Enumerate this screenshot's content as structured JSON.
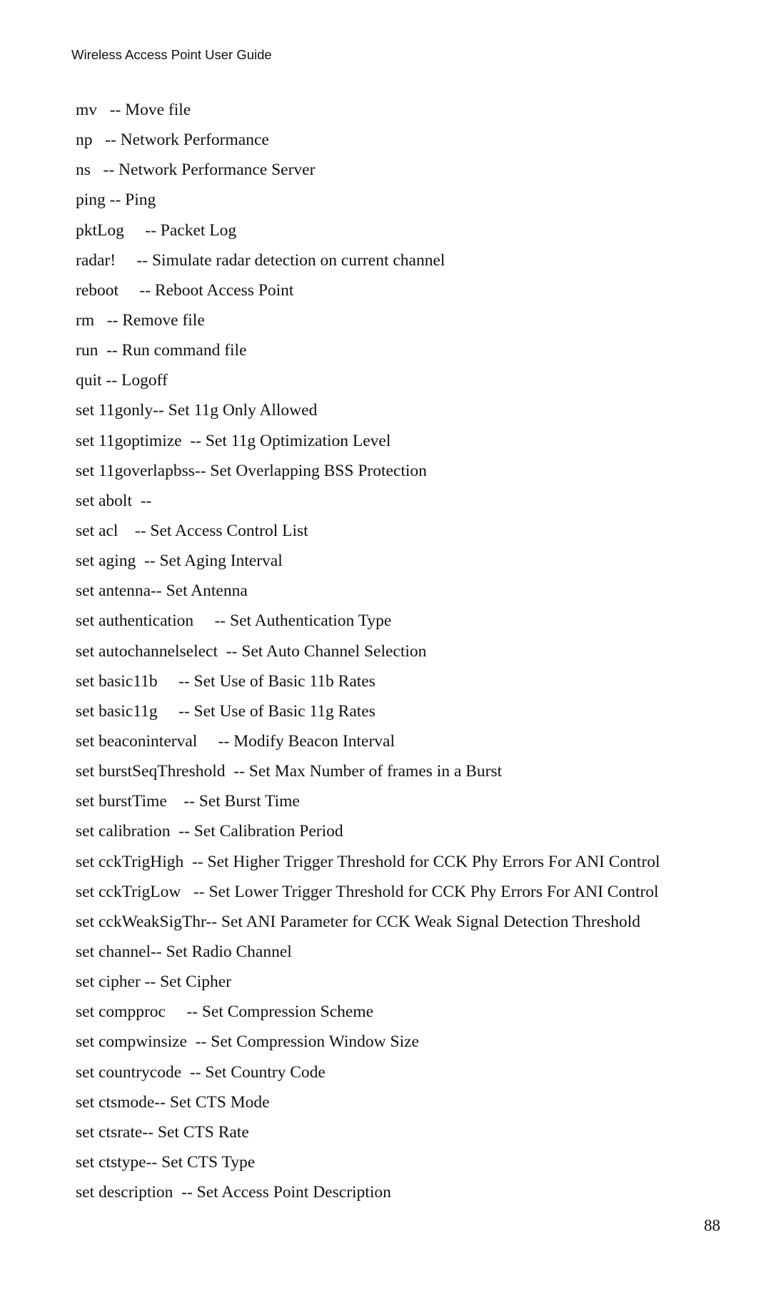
{
  "header": {
    "title": "Wireless Access Point User Guide"
  },
  "commands": [
    "mv   -- Move file",
    "np   -- Network Performance",
    "ns   -- Network Performance Server",
    "ping -- Ping",
    "pktLog     -- Packet Log",
    "radar!     -- Simulate radar detection on current channel",
    "reboot     -- Reboot Access Point",
    "rm   -- Remove file",
    "run  -- Run command file",
    "quit -- Logoff",
    "set 11gonly-- Set 11g Only Allowed",
    "set 11goptimize  -- Set 11g Optimization Level",
    "set 11goverlapbss-- Set Overlapping BSS Protection",
    "set abolt  --",
    "set acl    -- Set Access Control List",
    "set aging  -- Set Aging Interval",
    "set antenna-- Set Antenna",
    "set authentication     -- Set Authentication Type",
    "set autochannelselect  -- Set Auto Channel Selection",
    "set basic11b     -- Set Use of Basic 11b Rates",
    "set basic11g     -- Set Use of Basic 11g Rates",
    "set beaconinterval     -- Modify Beacon Interval",
    "set burstSeqThreshold  -- Set Max Number of frames in a Burst",
    "set burstTime    -- Set Burst Time",
    "set calibration  -- Set Calibration Period",
    "set cckTrigHigh  -- Set Higher Trigger Threshold for CCK Phy Errors For ANI Control",
    "set cckTrigLow   -- Set Lower Trigger Threshold for CCK Phy Errors For ANI Control",
    "set cckWeakSigThr-- Set ANI Parameter for CCK Weak Signal Detection Threshold",
    "set channel-- Set Radio Channel",
    "set cipher -- Set Cipher",
    "set compproc     -- Set Compression Scheme",
    "set compwinsize  -- Set Compression Window Size",
    "set countrycode  -- Set Country Code",
    "set ctsmode-- Set CTS Mode",
    "set ctsrate-- Set CTS Rate",
    "set ctstype-- Set CTS Type",
    "set description  -- Set Access Point Description"
  ],
  "footer": {
    "page_number": "88"
  }
}
